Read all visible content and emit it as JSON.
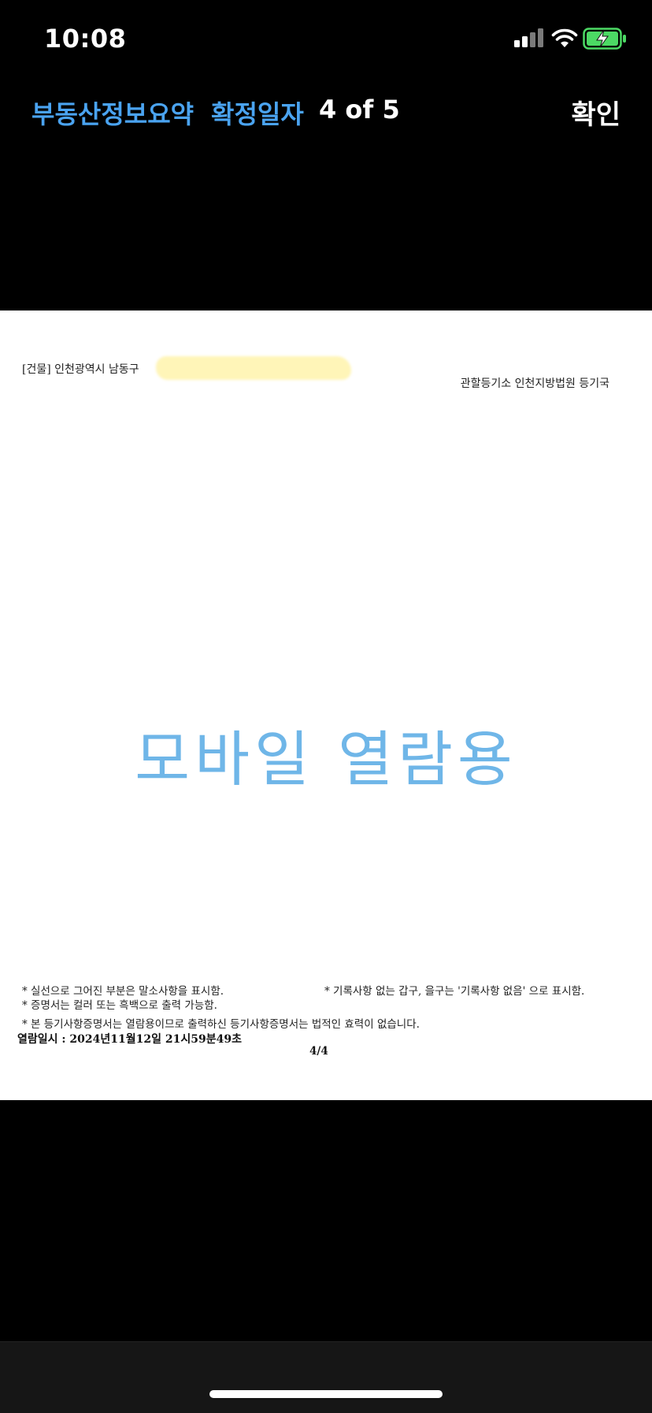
{
  "status_bar": {
    "time": "10:08",
    "icons": [
      "cellular-signal-icon",
      "wifi-icon",
      "battery-charging-icon"
    ],
    "battery_color": "#4cd964"
  },
  "nav": {
    "tabs": [
      {
        "label": "부동산정보요약"
      },
      {
        "label": "확정일자"
      }
    ],
    "page_counter": "4 of 5",
    "confirm_label": "확인",
    "accent_color": "#4aa3f0"
  },
  "document": {
    "address_prefix": "[건물] 인천광역시 남동구",
    "office": "관할등기소  인천지방법원 등기국",
    "watermark": "모바일 열람용",
    "watermark_color": "#6fb6e8",
    "notes": [
      "* 실선으로 그어진 부분은 말소사항을 표시함.",
      "* 기록사항 없는 갑구, 을구는 '기록사항 없음' 으로 표시함.",
      "* 증명서는 컬러 또는 흑백으로 출력 가능함.",
      "* 본 등기사항증명서는 열람용이므로 출력하신 등기사항증명서는 법적인 효력이 없습니다."
    ],
    "viewed_at": "열람일시 :  2024년11월12일  21시59분49초",
    "page_number": "4/4"
  }
}
